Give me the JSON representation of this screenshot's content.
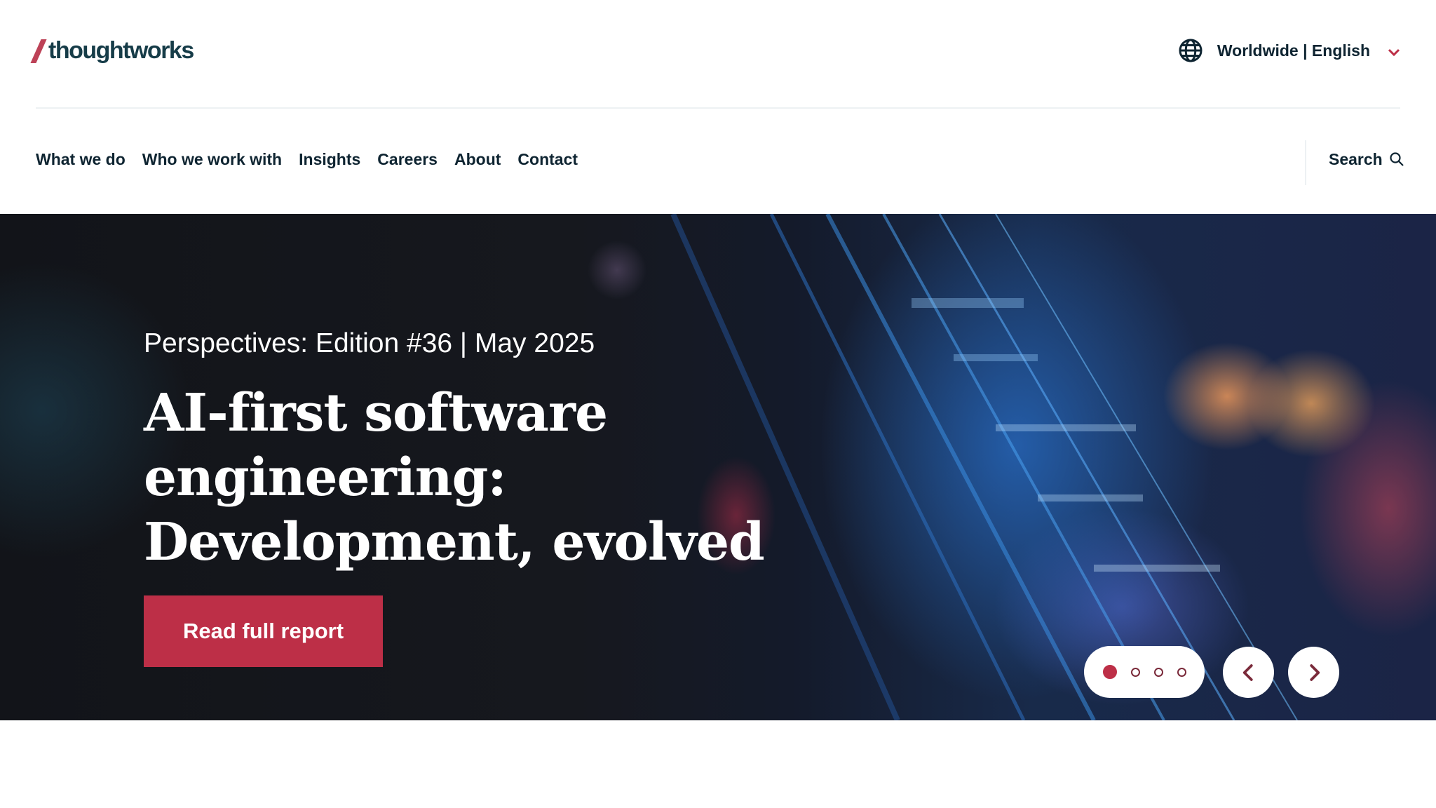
{
  "header": {
    "logo_text": "thoughtworks",
    "locale_label": "Worldwide | English"
  },
  "nav": {
    "items": [
      {
        "label": "What we do"
      },
      {
        "label": "Who we work with"
      },
      {
        "label": "Insights"
      },
      {
        "label": "Careers"
      },
      {
        "label": "About"
      },
      {
        "label": "Contact"
      }
    ],
    "search_label": "Search"
  },
  "hero": {
    "eyebrow": "Perspectives: Edition #36 | May 2025",
    "title_line1": "AI-first software engineering:",
    "title_line2": "Development, evolved",
    "cta_label": "Read full report",
    "slide_count": 4,
    "active_slide": 1
  },
  "colors": {
    "brand": "#bd2f47",
    "logo_slash": "#bd4257",
    "text_dark": "#0e2431"
  },
  "icons": {
    "globe": "globe-icon",
    "chevron": "chevron-down-icon",
    "search": "search-icon",
    "prev": "chevron-left-icon",
    "next": "chevron-right-icon"
  }
}
